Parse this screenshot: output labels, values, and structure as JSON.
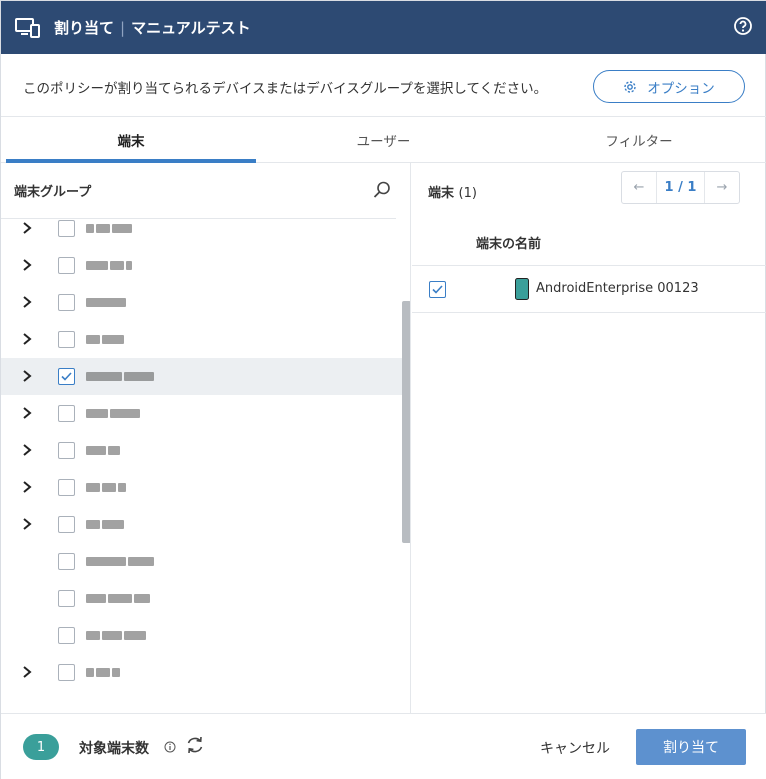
{
  "header": {
    "title": "割り当て",
    "subtitle": "マニュアルテスト",
    "help_icon": "help-circle-icon",
    "app_icon": "monitor-devices-icon"
  },
  "description": {
    "text": "このポリシーが割り当てられるデバイスまたはデバイスグループを選択してください。",
    "options_button": "オプション",
    "options_icon": "gear-icon"
  },
  "tabs": [
    {
      "label": "端末",
      "active": true
    },
    {
      "label": "ユーザー",
      "active": false
    },
    {
      "label": "フィルター",
      "active": false
    }
  ],
  "left_panel": {
    "title": "端末グループ",
    "search_icon": "search-icon"
  },
  "tree_rows": [
    {
      "expandable": true,
      "checked": false
    },
    {
      "expandable": true,
      "checked": false
    },
    {
      "expandable": true,
      "checked": false
    },
    {
      "expandable": true,
      "checked": false
    },
    {
      "expandable": true,
      "checked": true,
      "selected": true
    },
    {
      "expandable": true,
      "checked": false
    },
    {
      "expandable": true,
      "checked": false
    },
    {
      "expandable": true,
      "checked": false
    },
    {
      "expandable": true,
      "checked": false
    },
    {
      "expandable": false,
      "checked": false
    },
    {
      "expandable": false,
      "checked": false
    },
    {
      "expandable": false,
      "checked": false
    },
    {
      "expandable": true,
      "checked": false
    }
  ],
  "right_panel": {
    "title": "端末",
    "count": "(1)",
    "pager": {
      "prev": "←",
      "page": "1 / 1",
      "next": "→"
    },
    "column_header": "端末の名前",
    "devices": [
      {
        "name": "AndroidEnterprise 00123",
        "checked": true,
        "icon": "phone-icon"
      }
    ]
  },
  "footer": {
    "count_badge": "1",
    "label": "対象端末数",
    "info_icon": "info-icon",
    "refresh_icon": "refresh-icon",
    "cancel": "キャンセル",
    "assign": "割り当て"
  },
  "colors": {
    "header_bg": "#2d4a73",
    "accent": "#3a7ec6",
    "badge": "#3a9f9a",
    "primary_button": "#5d91cf"
  }
}
